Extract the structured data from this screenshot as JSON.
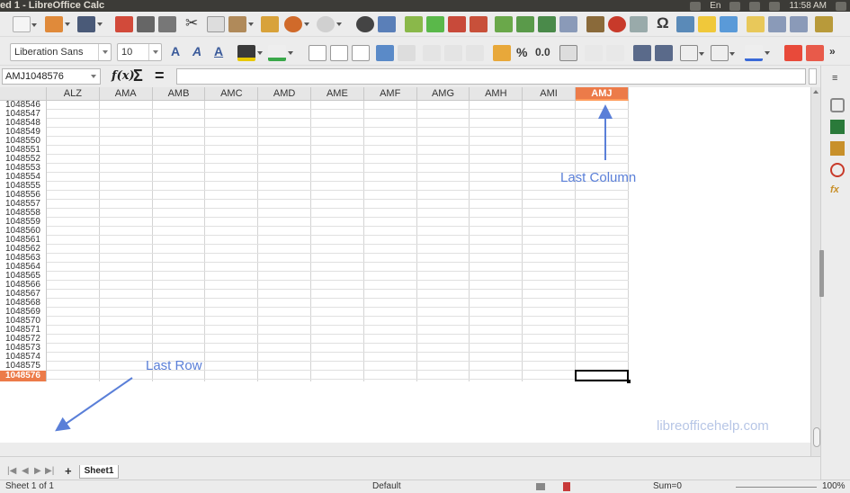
{
  "window": {
    "title": "ed 1 - LibreOffice Calc",
    "clock": "11:58 AM",
    "kb": "En"
  },
  "formatting": {
    "font_name": "Liberation Sans",
    "font_size": "10"
  },
  "formula_bar": {
    "name_box": "AMJ1048576",
    "fx_symbol": "f(x)",
    "sum_symbol": "Σ",
    "equals_symbol": "="
  },
  "columns": [
    "ALZ",
    "AMA",
    "AMB",
    "AMC",
    "AMD",
    "AME",
    "AMF",
    "AMG",
    "AMH",
    "AMI",
    "AMJ"
  ],
  "active_column": "AMJ",
  "rows": [
    "1048546",
    "1048547",
    "1048548",
    "1048549",
    "1048550",
    "1048551",
    "1048552",
    "1048553",
    "1048554",
    "1048555",
    "1048556",
    "1048557",
    "1048558",
    "1048559",
    "1048560",
    "1048561",
    "1048562",
    "1048563",
    "1048564",
    "1048565",
    "1048566",
    "1048567",
    "1048568",
    "1048569",
    "1048570",
    "1048571",
    "1048572",
    "1048573",
    "1048574",
    "1048575",
    "1048576"
  ],
  "active_row": "1048576",
  "annotations": {
    "last_column": "Last Column",
    "last_row": "Last Row",
    "watermark": "libreofficehelp.com"
  },
  "sheet_tabs": {
    "add_symbol": "+",
    "tabs": [
      "Sheet1"
    ]
  },
  "status": {
    "sheet": "Sheet 1 of 1",
    "page_style": "Default",
    "sum": "Sum=0",
    "zoom": "100%"
  },
  "colors": {
    "header_active": "#ec7b49",
    "annotation": "#5a7fd8",
    "watermark": "#b7c6e6"
  }
}
